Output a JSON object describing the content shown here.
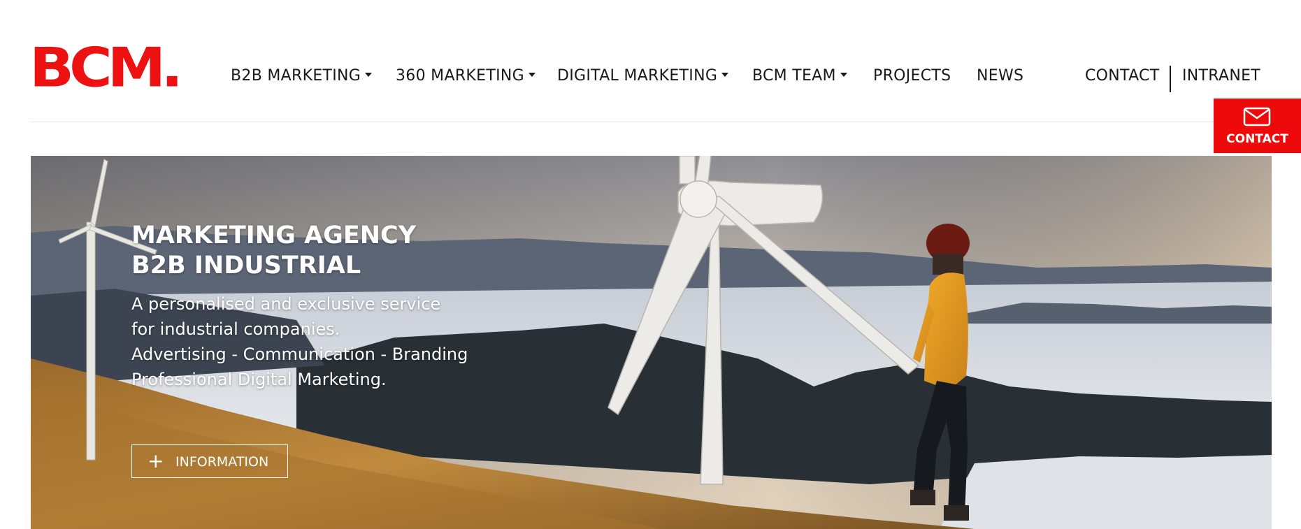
{
  "brand": {
    "logo_text": "BCM.",
    "accent_color": "#ee0a0a"
  },
  "nav": {
    "items": [
      {
        "label": "B2B MARKETING",
        "has_dropdown": true
      },
      {
        "label": "360 MARKETING",
        "has_dropdown": true
      },
      {
        "label": "DIGITAL MARKETING",
        "has_dropdown": true
      },
      {
        "label": "BCM TEAM",
        "has_dropdown": true
      },
      {
        "label": "PROJECTS",
        "has_dropdown": false
      },
      {
        "label": "NEWS",
        "has_dropdown": false
      }
    ],
    "contact_label": "CONTACT",
    "intranet_label": "INTRANET"
  },
  "floating_contact": {
    "label": "CONTACT",
    "icon": "envelope-icon"
  },
  "hero": {
    "title_lines": [
      "MARKETING AGENCY",
      "B2B INDUSTRIAL"
    ],
    "subtitle_lines": [
      "A personalised and exclusive service",
      "for industrial companies.",
      "Advertising - Communication - Branding",
      "Professional Digital Marketing."
    ],
    "button": {
      "label": "INFORMATION",
      "icon": "plus-icon"
    }
  }
}
